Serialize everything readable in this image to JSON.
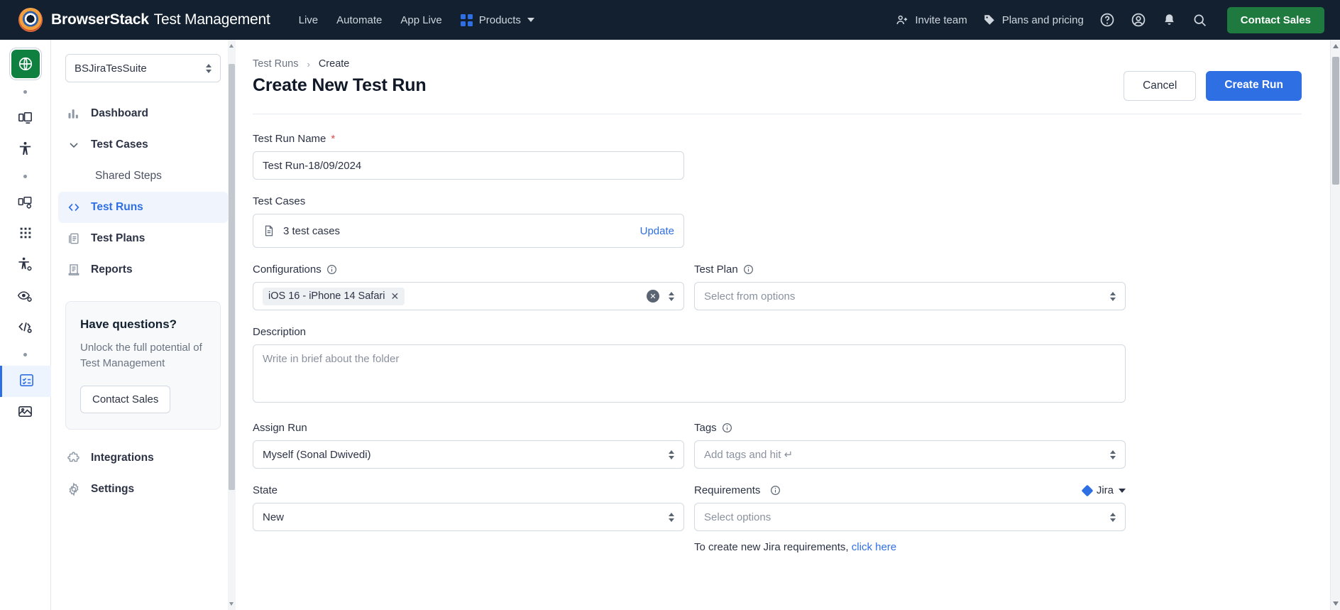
{
  "topbar": {
    "brand": "BrowserStack",
    "product": "Test Management",
    "nav": [
      {
        "label": "Live",
        "name": "topnav-live"
      },
      {
        "label": "Automate",
        "name": "topnav-automate"
      },
      {
        "label": "App Live",
        "name": "topnav-app-live"
      }
    ],
    "products_label": "Products",
    "invite_team": "Invite team",
    "plans_pricing": "Plans and pricing",
    "contact_sales": "Contact Sales",
    "icons": [
      "person-add-icon",
      "tag-icon",
      "help-circle-icon",
      "account-circle-icon",
      "bell-icon",
      "search-icon"
    ],
    "accent_green": "#1f7a3f",
    "bg": "#12202f"
  },
  "rail": {
    "items": [
      "globe-icon",
      "dot-separator",
      "responsive-icon",
      "accessibility-icon",
      "dot-separator",
      "responsive-settings-icon",
      "grid-apps-icon",
      "accessibility-settings-icon",
      "visual-testing-icon",
      "code-settings-icon",
      "dot-separator",
      "test-management-icon",
      "screenshots-icon"
    ]
  },
  "sidebar": {
    "project": "BSJiraTesSuite",
    "items": [
      {
        "label": "Dashboard",
        "icon": "bar-chart-icon",
        "active": false,
        "sub": false
      },
      {
        "label": "Test Cases",
        "icon": "chevron-down-icon",
        "active": false,
        "sub": false
      },
      {
        "label": "Shared Steps",
        "icon": "none",
        "active": false,
        "sub": true
      },
      {
        "label": "Test Runs",
        "icon": "code-brackets-icon",
        "active": true,
        "sub": false
      },
      {
        "label": "Test Plans",
        "icon": "documents-icon",
        "active": false,
        "sub": false
      },
      {
        "label": "Reports",
        "icon": "report-icon",
        "active": false,
        "sub": false
      }
    ],
    "promo": {
      "title": "Have questions?",
      "body": "Unlock the full potential of Test Management",
      "button": "Contact Sales"
    },
    "bottom_items": [
      {
        "label": "Integrations",
        "icon": "puzzle-icon"
      },
      {
        "label": "Settings",
        "icon": "gear-icon"
      }
    ]
  },
  "main": {
    "breadcrumb": {
      "parent": "Test Runs",
      "separator": "›",
      "current": "Create"
    },
    "title": "Create New Test Run",
    "cancel_label": "Cancel",
    "create_label": "Create Run",
    "fields": {
      "test_run_name": {
        "label": "Test Run Name",
        "required": "*",
        "value": "Test Run-18/09/2024"
      },
      "test_cases": {
        "label": "Test Cases",
        "value": "3 test cases",
        "action": "Update",
        "icon": "document-icon"
      },
      "configurations": {
        "label": "Configurations",
        "info": "info-icon",
        "chip": "iOS 16 - iPhone 14 Safari",
        "chip_remove": "✕"
      },
      "test_plan": {
        "label": "Test Plan",
        "info": "info-icon",
        "placeholder": "Select from options"
      },
      "description": {
        "label": "Description",
        "placeholder": "Write in brief about the folder"
      },
      "assign_run": {
        "label": "Assign Run",
        "value": "Myself (Sonal Dwivedi)"
      },
      "tags": {
        "label": "Tags",
        "info": "info-icon",
        "placeholder": "Add tags and hit ↵"
      },
      "state": {
        "label": "State",
        "value": "New"
      },
      "requirements": {
        "label": "Requirements",
        "info": "info-icon",
        "placeholder": "Select options",
        "provider": "Jira",
        "note_prefix": "To create new Jira requirements,",
        "note_link": "click here"
      }
    }
  }
}
